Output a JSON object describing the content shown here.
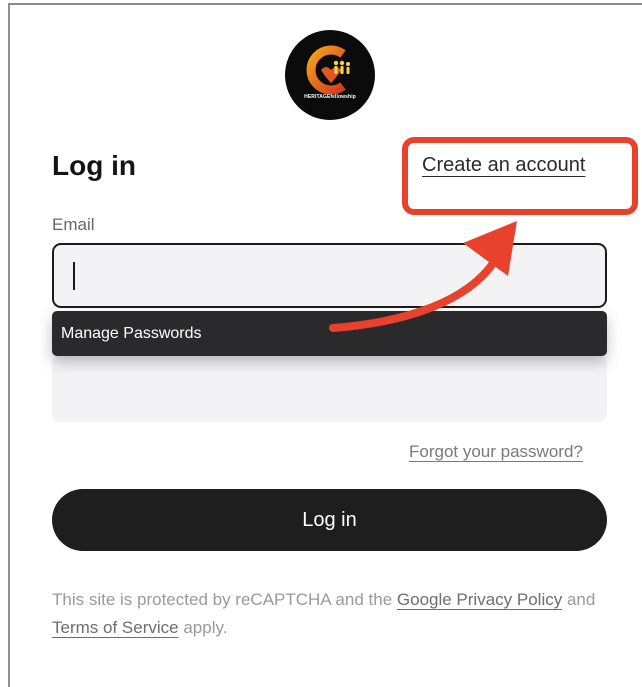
{
  "logo": {
    "text": "HERITAGEfellowship",
    "icon": "heritage-fellowship-logo"
  },
  "header": {
    "title": "Log in",
    "create_account": "Create an account"
  },
  "form": {
    "email_label": "Email",
    "email_value": "",
    "autofill_option": "Manage Passwords",
    "forgot_password": "Forgot your password?",
    "submit_label": "Log in"
  },
  "legal": {
    "prefix": "This site is protected by reCAPTCHA and the",
    "privacy_link": "Google Privacy Policy",
    "and": "and",
    "terms_link": "Terms of Service",
    "suffix": "apply."
  },
  "annotation": {
    "color": "#e8412c"
  },
  "colors": {
    "button": "#1e1e1e",
    "input_bg": "#f3f3f5",
    "dropdown_bg": "#2a2a2c"
  }
}
